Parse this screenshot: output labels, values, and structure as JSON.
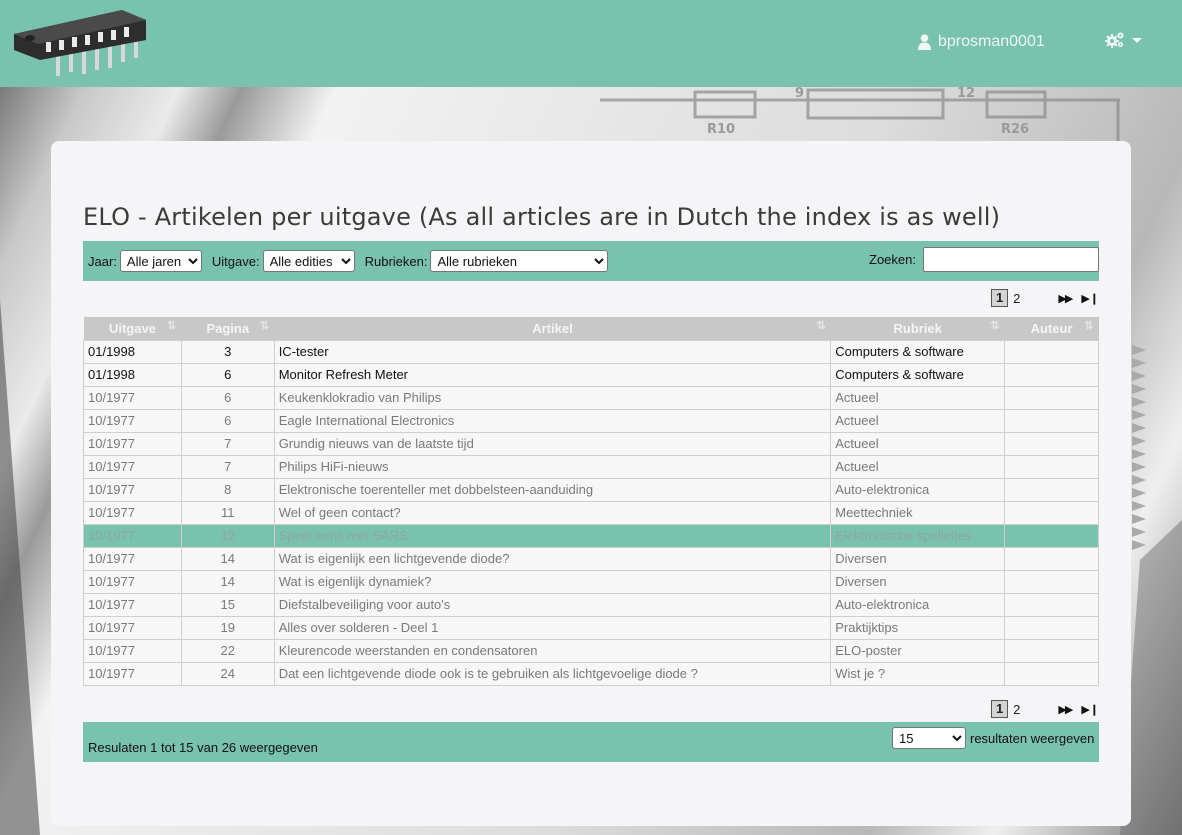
{
  "header": {
    "username": "bprosman0001"
  },
  "page": {
    "title": "ELO - Artikelen per uitgave (As all articles are in Dutch the index is as well)"
  },
  "filters": {
    "year_label": "Jaar:",
    "year_value": "Alle jaren",
    "edition_label": "Uitgave:",
    "edition_value": "Alle edities",
    "category_label": "Rubrieken:",
    "category_value": "Alle rubrieken",
    "search_label": "Zoeken:",
    "search_value": ""
  },
  "pagination": {
    "current": "1",
    "next_page": "2",
    "next_icon": "▶▶",
    "last_icon": "▶❙"
  },
  "table": {
    "columns": [
      "Uitgave",
      "Pagina",
      "Artikel",
      "Rubriek",
      "Auteur"
    ],
    "rows": [
      {
        "uitgave": "01/1998",
        "pagina": "3",
        "artikel": "IC-tester",
        "rubriek": "Computers & software",
        "auteur": ""
      },
      {
        "uitgave": "01/1998",
        "pagina": "6",
        "artikel": "Monitor Refresh Meter",
        "rubriek": "Computers & software",
        "auteur": ""
      },
      {
        "uitgave": "10/1977",
        "pagina": "6",
        "artikel": "Keukenklokradio van Philips",
        "rubriek": "Actueel",
        "auteur": ""
      },
      {
        "uitgave": "10/1977",
        "pagina": "6",
        "artikel": "Eagle International Electronics",
        "rubriek": "Actueel",
        "auteur": ""
      },
      {
        "uitgave": "10/1977",
        "pagina": "7",
        "artikel": "Grundig nieuws van de laatste tijd",
        "rubriek": "Actueel",
        "auteur": ""
      },
      {
        "uitgave": "10/1977",
        "pagina": "7",
        "artikel": "Philips HiFi-nieuws",
        "rubriek": "Actueel",
        "auteur": ""
      },
      {
        "uitgave": "10/1977",
        "pagina": "8",
        "artikel": "Elektronische toerenteller met dobbelsteen-aanduiding",
        "rubriek": "Auto-elektronica",
        "auteur": ""
      },
      {
        "uitgave": "10/1977",
        "pagina": "11",
        "artikel": "Wel of geen contact?",
        "rubriek": "Meettechniek",
        "auteur": ""
      },
      {
        "uitgave": "10/1977",
        "pagina": "12",
        "artikel": "Speel eens met SARS",
        "rubriek": "Elektronische spelletjes",
        "auteur": ""
      },
      {
        "uitgave": "10/1977",
        "pagina": "14",
        "artikel": "Wat is eigenlijk een lichtgevende diode?",
        "rubriek": "Diversen",
        "auteur": ""
      },
      {
        "uitgave": "10/1977",
        "pagina": "14",
        "artikel": "Wat is eigenlijk dynamiek?",
        "rubriek": "Diversen",
        "auteur": ""
      },
      {
        "uitgave": "10/1977",
        "pagina": "15",
        "artikel": "Diefstalbeveiliging voor auto's",
        "rubriek": "Auto-elektronica",
        "auteur": ""
      },
      {
        "uitgave": "10/1977",
        "pagina": "19",
        "artikel": "Alles over solderen - Deel 1",
        "rubriek": "Praktijktips",
        "auteur": ""
      },
      {
        "uitgave": "10/1977",
        "pagina": "22",
        "artikel": "Kleurencode weerstanden en condensatoren",
        "rubriek": "ELO-poster",
        "auteur": ""
      },
      {
        "uitgave": "10/1977",
        "pagina": "24",
        "artikel": "Dat een lichtgevende diode ook is te gebruiken als lichtgevoelige diode ?",
        "rubriek": "Wist je ?",
        "auteur": ""
      }
    ]
  },
  "footer": {
    "results_text": "Resulaten 1 tot 15 van 26 weergegeven",
    "per_page_value": "15",
    "per_page_label": "resultaten weergeven"
  },
  "background": {
    "labels": [
      "R10",
      "R26",
      "9",
      "12"
    ]
  },
  "colors": {
    "accent": "#79c2ad",
    "card": "#f5f5f7",
    "header_text": "#eef7f4"
  }
}
